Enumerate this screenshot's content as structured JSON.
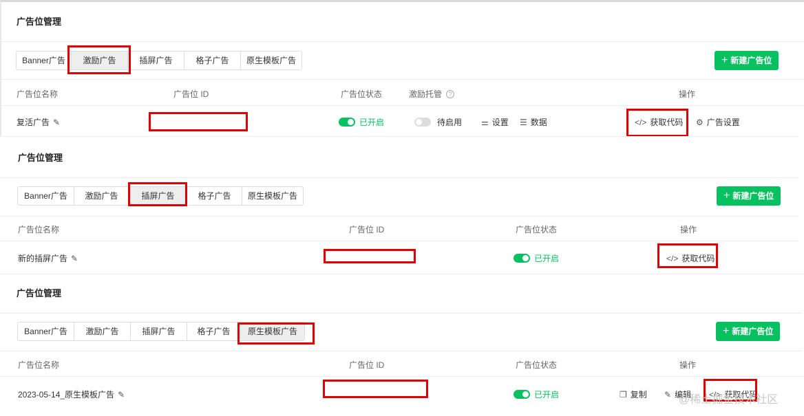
{
  "colors": {
    "accent": "#07c160",
    "highlight": "#e00000"
  },
  "tab_labels": [
    "Banner广告",
    "激励广告",
    "插屏广告",
    "格子广告",
    "原生模板广告"
  ],
  "panel1": {
    "title": "广告位管理",
    "active_tab": "激励广告",
    "new_button": "新建广告位",
    "headers": {
      "name": "广告位名称",
      "id": "广告位 ID",
      "status": "广告位状态",
      "hosting": "激励托管",
      "ops": "操作"
    },
    "row": {
      "name": "复活广告",
      "status": "已开启",
      "hosting": "待启用",
      "settings": "设置",
      "data": "数据",
      "get_code": "获取代码",
      "ad_settings": "广告设置"
    }
  },
  "panel2": {
    "title": "广告位管理",
    "active_tab": "插屏广告",
    "new_button": "新建广告位",
    "headers": {
      "name": "广告位名称",
      "id": "广告位 ID",
      "status": "广告位状态",
      "ops": "操作"
    },
    "row": {
      "name": "新的插屏广告",
      "status": "已开启",
      "get_code": "获取代码"
    }
  },
  "panel3": {
    "title": "广告位管理",
    "active_tab": "原生模板广告",
    "new_button": "新建广告位",
    "headers": {
      "name": "广告位名称",
      "id": "广告位 ID",
      "status": "广告位状态",
      "ops": "操作"
    },
    "row": {
      "name": "2023-05-14_原生模板广告",
      "status": "已开启",
      "copy": "复制",
      "edit": "编辑",
      "get_code": "获取代码"
    }
  },
  "watermark": "@稀土掘金技术社区"
}
